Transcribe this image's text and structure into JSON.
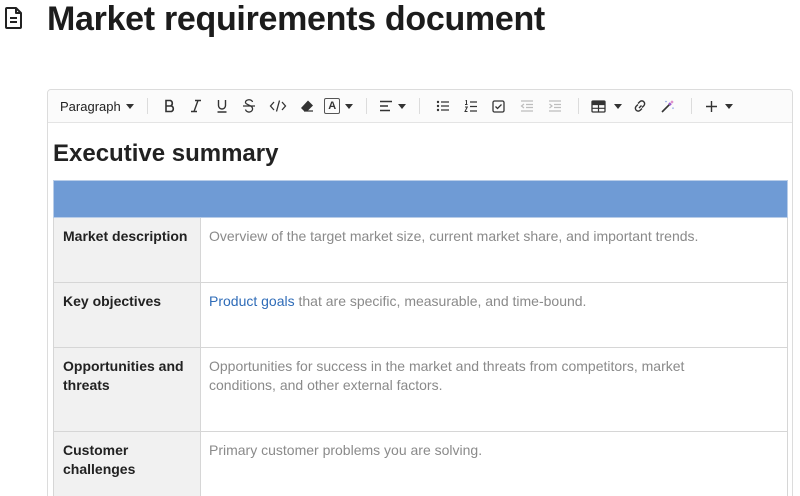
{
  "page": {
    "title": "Market requirements document",
    "icon": "document-icon"
  },
  "toolbar": {
    "paragraph_label": "Paragraph",
    "text_color_label": "A",
    "buttons": [
      "bold-icon",
      "italic-icon",
      "underline-icon",
      "strikethrough-icon",
      "code-icon",
      "clear-format-icon",
      "text-color-icon",
      "align-icon",
      "bullet-list-icon",
      "numbered-list-icon",
      "checklist-icon",
      "outdent-icon",
      "indent-icon",
      "table-icon",
      "link-icon",
      "magic-wand-icon",
      "plus-icon"
    ]
  },
  "content": {
    "heading": "Executive summary",
    "header_color": "#6f9bd5",
    "rows": [
      {
        "label": "Market description",
        "value": "Overview of the target market size, current market share, and important trends."
      },
      {
        "label": "Key objectives",
        "link": "Product goals",
        "value": " that are specific, measurable, and time-bound."
      },
      {
        "label_line1": "Opportunities and",
        "label_line2": "threats",
        "value_line1": "Opportunities for success in the market and threats from competitors, market",
        "value_line2": "conditions, and other external factors."
      },
      {
        "label_line1": "Customer",
        "label_line2": "challenges",
        "value": "Primary customer problems you are solving."
      }
    ]
  }
}
